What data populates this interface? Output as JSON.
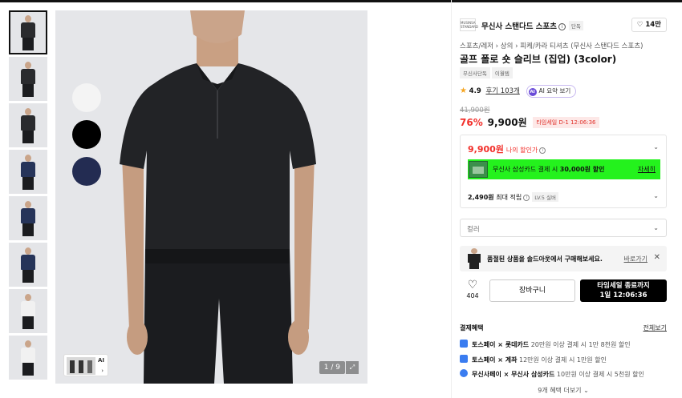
{
  "gallery": {
    "thumbnails": [
      {
        "shirt": "#2a2b2e"
      },
      {
        "shirt": "#2a2b2e"
      },
      {
        "shirt": "#2a2b2e"
      },
      {
        "shirt": "#263459"
      },
      {
        "shirt": "#263459"
      },
      {
        "shirt": "#263459"
      },
      {
        "shirt": "#f1f1f1"
      },
      {
        "shirt": "#f1f1f1"
      }
    ],
    "swatches": [
      {
        "color": "#f4f4f4",
        "icon": "white-swatch"
      },
      {
        "color": "#000000",
        "icon": "black-swatch"
      },
      {
        "color": "#232c52",
        "icon": "navy-swatch"
      }
    ],
    "counter": "1 / 9",
    "ai_chip_label": "AI",
    "ai_chip_arrow": "›"
  },
  "brand": {
    "logo_text": "MUSINSA STANDARD",
    "name": "무신사 스탠다드 스포츠",
    "tag": "단독",
    "like_count": "14만"
  },
  "breadcrumb": "스포츠/레저 › 상의 › 피케/카라 티셔츠 (무신사 스탠다드 스포츠)",
  "product": {
    "title": "골프 폴로 숏 슬리브 (집업) (3color)",
    "tags": [
      "무신사단독",
      "이월템"
    ],
    "rating": "4.9",
    "review_link": "후기 103개",
    "ai_summary_label": "AI 요약 보기",
    "ai_dot": "AI",
    "original_price": "41,900원",
    "discount_rate": "76%",
    "price": "9,900원",
    "timesale_badge": "타임세일 D-1 12:06:36"
  },
  "discount_box": {
    "my_price": "9,900원",
    "my_price_label": "나의 할인가",
    "card_text_prefix": "무신사 삼성카드 결제 시 ",
    "card_text_amount": "30,000원 할인",
    "card_link": "자세히",
    "points_amount": "2,490원",
    "points_label": " 최대 적립",
    "level_badge": "LV.5 실버"
  },
  "color_select_placeholder": "컬러",
  "soldout": {
    "text": "품절된 상품을 솔드아웃에서 구매해보세요.",
    "link": "바로가기",
    "close": "✕"
  },
  "actions": {
    "like_count": "404",
    "cart_label": "장바구니",
    "buy_line1": "타임세일 종료까지",
    "buy_line2": "1일 12:06:36"
  },
  "benefits": {
    "title": "결제혜택",
    "more": "전체보기",
    "items": [
      {
        "bold": "토스페이 × 롯데카드",
        "text": " 20만원 이상 결제 시 1만 8천원 할인"
      },
      {
        "bold": "토스페이 × 계좌",
        "text": " 12만원 이상 결제 시 1만원 할인"
      },
      {
        "bold": "무신사페이 × 무신사 삼성카드",
        "text": " 10만원 이상 결제 시 5천원 할인"
      }
    ],
    "expand": "9개 혜택 더보기 ⌄"
  },
  "icons": {
    "info": "i",
    "heart": "♡",
    "chevron": "⌄",
    "star": "★",
    "expand": "⤢"
  }
}
